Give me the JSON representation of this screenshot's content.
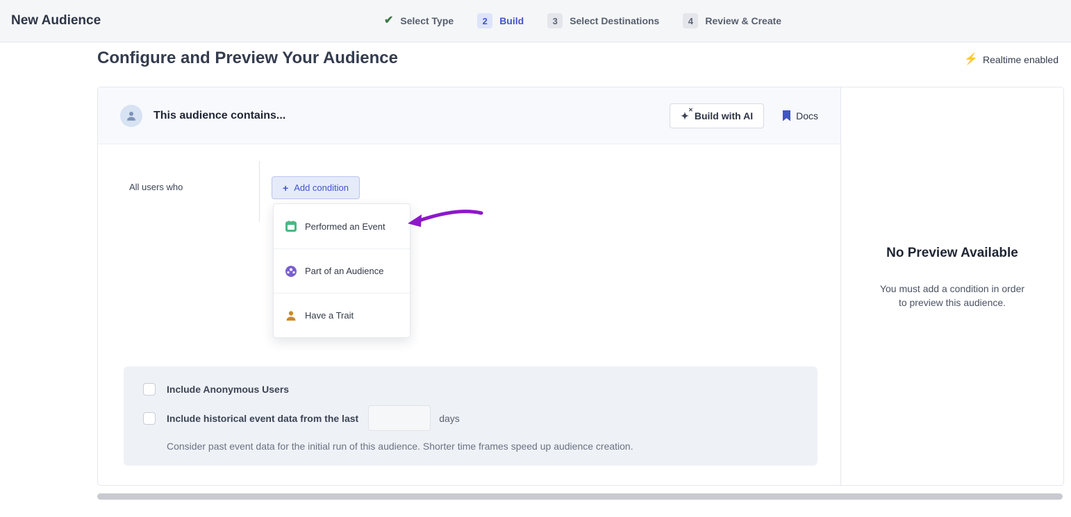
{
  "topbar": {
    "title": "New Audience",
    "steps": [
      {
        "num": "",
        "label": "Select Type",
        "state": "done"
      },
      {
        "num": "2",
        "label": "Build",
        "state": "active"
      },
      {
        "num": "3",
        "label": "Select Destinations",
        "state": "todo"
      },
      {
        "num": "4",
        "label": "Review & Create",
        "state": "todo"
      }
    ]
  },
  "page": {
    "title": "Configure and Preview Your Audience",
    "realtime_label": "Realtime enabled"
  },
  "builder": {
    "header_title": "This audience contains...",
    "build_with_ai_label": "Build with AI",
    "docs_label": "Docs",
    "all_users_label": "All users who",
    "add_condition_label": "Add condition",
    "menu_items": [
      {
        "label": "Performed an Event"
      },
      {
        "label": "Part of an Audience"
      },
      {
        "label": "Have a Trait"
      }
    ],
    "options": {
      "anonymous_label": "Include Anonymous Users",
      "historical_label": "Include historical event data from the last",
      "days_value": "",
      "days_label": "days",
      "helper_text": "Consider past event data for the initial run of this audience. Shorter time frames speed up audience creation."
    }
  },
  "preview": {
    "title": "No Preview Available",
    "message": "You must add a condition in order to preview this audience."
  },
  "colors": {
    "accent_blue": "#4055c8",
    "step_done_check": "#3c7a46",
    "realtime_bolt": "#f2b10e",
    "annotation_arrow": "#8d18c9",
    "event_icon_green": "#4cb782",
    "audience_icon_purple": "#7a5fd0",
    "trait_icon_amber": "#c98a2e"
  }
}
